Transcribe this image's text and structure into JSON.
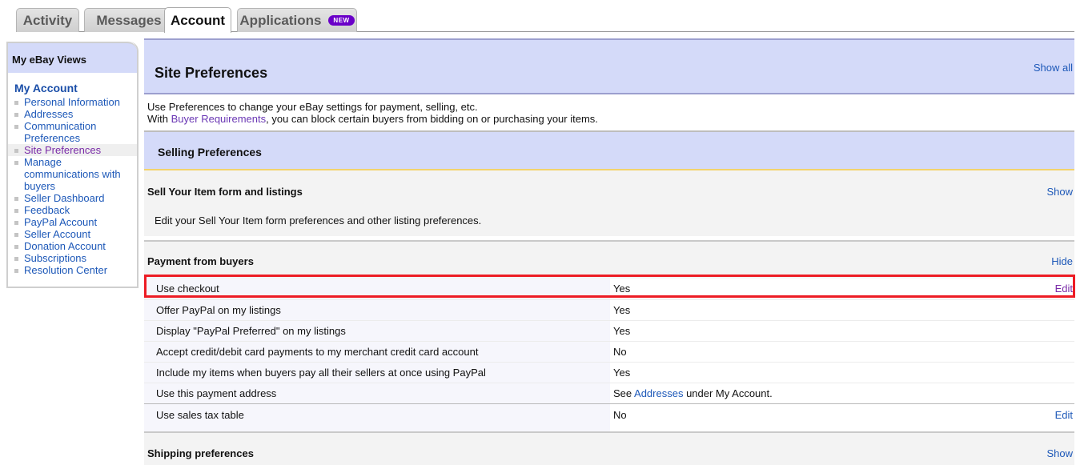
{
  "tabs": [
    {
      "label": "Activity",
      "active": false
    },
    {
      "label": "Messages",
      "active": false
    },
    {
      "label": "Account",
      "active": true
    },
    {
      "label": "Applications",
      "active": false,
      "badge": "NEW"
    }
  ],
  "sidebar": {
    "header": "My eBay Views",
    "section_title": "My Account",
    "items": [
      {
        "label": "Personal Information"
      },
      {
        "label": "Addresses"
      },
      {
        "label": "Communication Preferences"
      },
      {
        "label": "Site Preferences",
        "current": true
      },
      {
        "label": "Manage communications with buyers"
      },
      {
        "label": "Seller Dashboard"
      },
      {
        "label": "Feedback"
      },
      {
        "label": "PayPal Account"
      },
      {
        "label": "Seller Account"
      },
      {
        "label": "Donation Account"
      },
      {
        "label": "Subscriptions"
      },
      {
        "label": "Resolution Center"
      }
    ]
  },
  "main": {
    "title": "Site Preferences",
    "show_all": "Show all",
    "intro_line1": "Use Preferences to change your eBay settings for payment, selling, etc.",
    "intro_line2_prefix": "With ",
    "intro_line2_link": "Buyer Requirements",
    "intro_line2_suffix": ", you can block certain buyers from bidding on or purchasing your items.",
    "selling_header": "Selling Preferences",
    "sell_your_item": {
      "title": "Sell Your Item form and listings",
      "link": "Show",
      "description": "Edit your Sell Your Item form preferences and other listing preferences."
    },
    "payment": {
      "title": "Payment from buyers",
      "link": "Hide",
      "rows": [
        {
          "label": "Use checkout",
          "value": "Yes",
          "action": "Edit",
          "highlighted": true
        },
        {
          "label": "Offer PayPal on my listings",
          "value": "Yes",
          "action": ""
        },
        {
          "label": "Display \"PayPal Preferred\" on my listings",
          "value": "Yes",
          "action": ""
        },
        {
          "label": "Accept credit/debit card payments to my merchant credit card account",
          "value": "No",
          "action": ""
        },
        {
          "label": "Include my items when buyers pay all their sellers at once using PayPal",
          "value": "Yes",
          "action": ""
        },
        {
          "label": "Use this payment address",
          "value_prefix": "See ",
          "value_link": "Addresses",
          "value_suffix": " under My Account.",
          "action": ""
        },
        {
          "label": "Use sales tax table",
          "value": "No",
          "action": "Edit"
        }
      ]
    },
    "shipping": {
      "title": "Shipping preferences",
      "link": "Show"
    }
  },
  "colors": {
    "header_lavender": "#d4daf9",
    "link_blue": "#1d58b8",
    "visited_purple": "#7a2ba8",
    "highlight_red": "#ed1c24",
    "badge_purple": "#6a00c8"
  }
}
